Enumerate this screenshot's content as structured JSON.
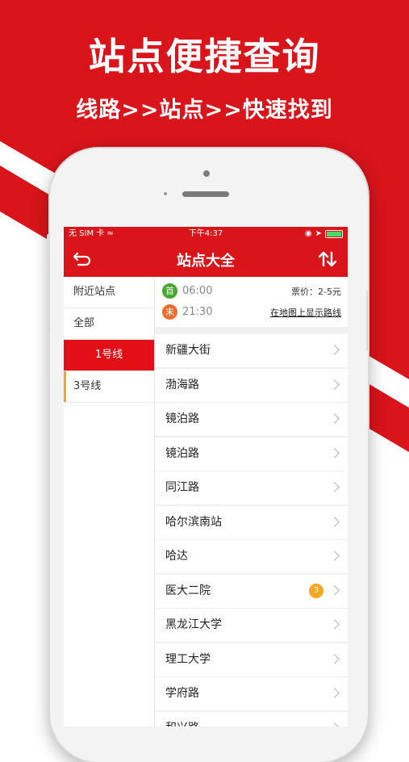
{
  "promo": {
    "title": "站点便捷查询",
    "subtitle": "线路>>站点>>快速找到",
    "accent_color": "#d9141b"
  },
  "status_bar": {
    "carrier": "无 SIM 卡",
    "time": "下午4:37"
  },
  "nav": {
    "title": "站点大全",
    "back_icon": "back-arrow-icon",
    "sort_icon": "swap-vertical-icon"
  },
  "sidebar": {
    "items": [
      {
        "label": "附近站点"
      },
      {
        "label": "全部"
      },
      {
        "label": "1号线"
      },
      {
        "label": "3号线"
      }
    ],
    "active_index": 2
  },
  "info": {
    "first_badge": "首",
    "first_time": "06:00",
    "last_badge": "末",
    "last_time": "21:30",
    "fare": "票价：2-5元",
    "map_link": "在地图上显示路线"
  },
  "stations": [
    {
      "name": "新疆大街"
    },
    {
      "name": "渤海路"
    },
    {
      "name": "镜泊路"
    },
    {
      "name": "镜泊路"
    },
    {
      "name": "同江路"
    },
    {
      "name": "哈尔滨南站"
    },
    {
      "name": "哈达"
    },
    {
      "name": "医大二院",
      "badge": "3"
    },
    {
      "name": "黑龙江大学"
    },
    {
      "name": "理工大学"
    },
    {
      "name": "学府路"
    },
    {
      "name": "和兴路"
    }
  ]
}
